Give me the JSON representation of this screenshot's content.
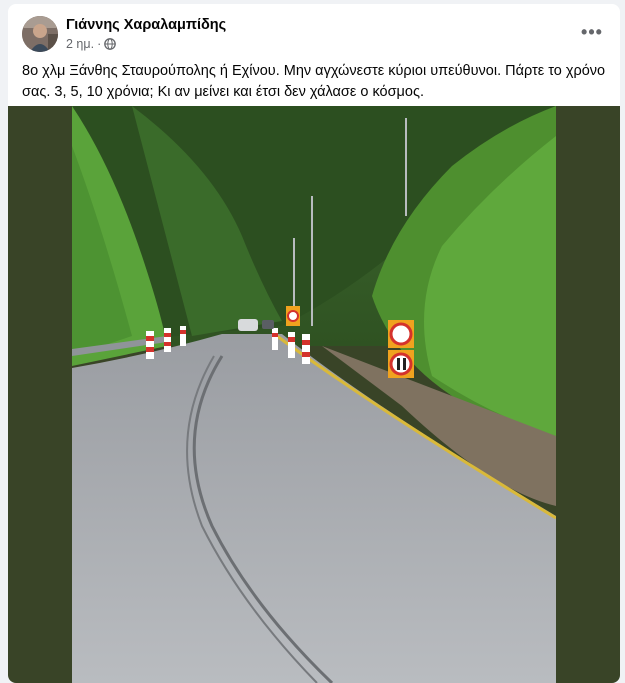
{
  "post": {
    "author": "Γιάννης Χαραλαμπίδης",
    "time": "2 ημ.",
    "separator": "·",
    "privacy_icon": "globe-icon",
    "more_icon": "more-options-icon",
    "more_label": "•••",
    "text": "8ο χλμ Ξάνθης Σταυρούπολης ή Εχίνου. Μην αγχώνεστε κύριοι υπεύθυνοι. Πάρτε το χρόνο σας. 3, 5, 10 χρόνια; Κι αν μείνει και έτσι δεν χάλασε ο κόσμος.",
    "photo_background": "#394427"
  }
}
